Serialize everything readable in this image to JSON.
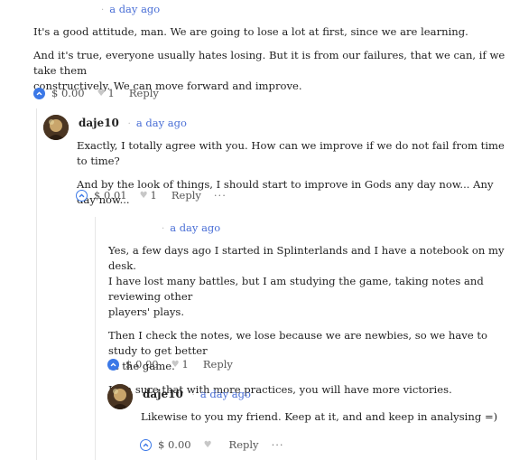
{
  "comment1": {
    "time": "a day ago",
    "paragraphs": [
      "It's a good attitude, man. We are going to lose a lot at first, since we are learning.",
      "And it's true, everyone usually hates losing. But it is from our failures, that we can, if we take them",
      "constructively. We can move forward and improve."
    ],
    "payout": "$ 0.00",
    "votes": "1",
    "reply_label": "Reply"
  },
  "comment2": {
    "author": "daje10",
    "time": "a day ago",
    "paragraphs": [
      "Exactly, I totally agree with you. How can we improve if we do not fail from time to time?",
      "And by the look of things, I should start to improve in Gods any day now... Any day now..."
    ],
    "payout": "$ 0.01",
    "votes": "1",
    "reply_label": "Reply",
    "more_label": "···"
  },
  "comment3": {
    "time": "a day ago",
    "lines": [
      "Yes, a few days ago I started in Splinterlands and I have a notebook on my desk.",
      "I have lost many battles, but I am studying the game, taking notes and reviewing other",
      "players' plays.",
      "Then I check the notes, we lose because we are newbies, so we have to study to get better",
      "at the game.",
      "I am sure that with more practices, you will have more victories."
    ],
    "payout": "$ 0.00",
    "votes": "1",
    "reply_label": "Reply"
  },
  "comment4": {
    "author": "daje10",
    "time": "a day ago",
    "text": "Likewise to you my friend. Keep at it, and and keep in analysing =)",
    "payout": "$ 0.00",
    "reply_label": "Reply",
    "more_label": "···"
  },
  "colors": {
    "accent": "#3b78e7",
    "link": "#4a6fd6"
  }
}
